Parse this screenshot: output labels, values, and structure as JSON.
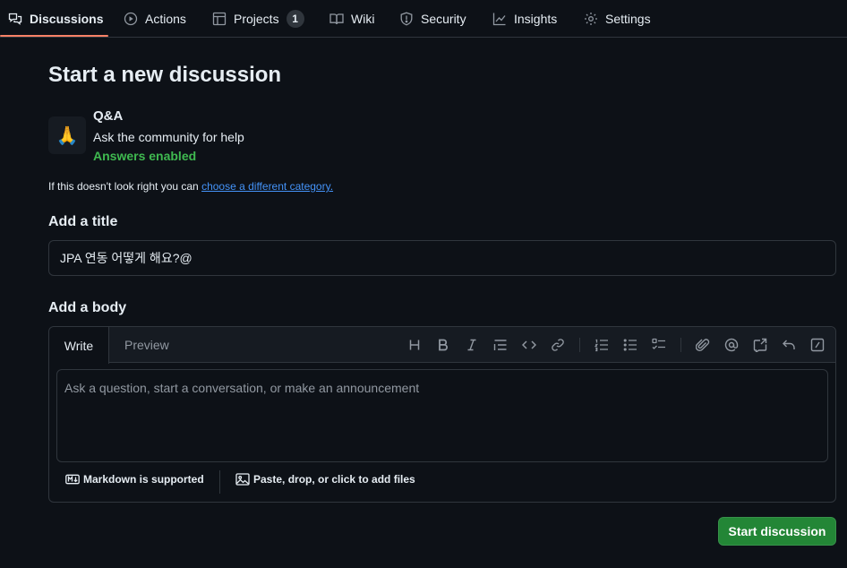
{
  "nav": {
    "tabs": [
      {
        "label": "Discussions",
        "icon": "comment-discussion-icon",
        "active": true
      },
      {
        "label": "Actions",
        "icon": "play-icon"
      },
      {
        "label": "Projects",
        "icon": "table-icon",
        "counter": "1"
      },
      {
        "label": "Wiki",
        "icon": "book-icon"
      },
      {
        "label": "Security",
        "icon": "shield-icon"
      },
      {
        "label": "Insights",
        "icon": "graph-icon"
      },
      {
        "label": "Settings",
        "icon": "gear-icon"
      }
    ]
  },
  "page": {
    "title": "Start a new discussion"
  },
  "category": {
    "emoji": "🙏",
    "name": "Q&A",
    "description": "Ask the community for help",
    "status": "Answers enabled",
    "hint_prefix": "If this doesn't look right you can ",
    "hint_link": "choose a different category."
  },
  "title_field": {
    "label": "Add a title",
    "value": "JPA 연동 어떻게 해요?@"
  },
  "body_field": {
    "label": "Add a body",
    "tab_write": "Write",
    "tab_preview": "Preview",
    "placeholder": "Ask a question, start a conversation, or make an announcement",
    "markdown_note": "Markdown is supported",
    "attach_note": "Paste, drop, or click to add files"
  },
  "toolbar_icons": [
    "heading-icon",
    "bold-icon",
    "italic-icon",
    "quote-icon",
    "code-icon",
    "link-icon",
    "ordered-list-icon",
    "unordered-list-icon",
    "task-list-icon",
    "paperclip-icon",
    "mention-icon",
    "reference-icon",
    "undo-icon",
    "slash-command-icon"
  ],
  "submit": {
    "label": "Start discussion"
  },
  "colors": {
    "accent_underline": "#f78166",
    "link": "#4493f8",
    "success": "#3fb950",
    "primary_button": "#238636",
    "background": "#0d1117"
  }
}
